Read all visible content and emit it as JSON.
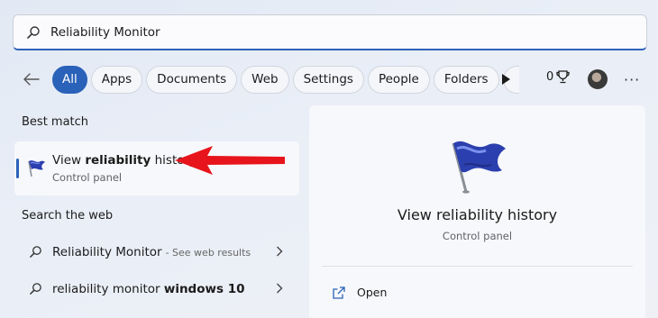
{
  "search": {
    "query": "Reliability Monitor"
  },
  "filters": {
    "items": [
      "All",
      "Apps",
      "Documents",
      "Web",
      "Settings",
      "People",
      "Folders"
    ],
    "active": "All",
    "points": "0"
  },
  "best_match": {
    "label": "Best match",
    "title_pre": "View ",
    "title_bold": "reliability",
    "title_post": " history",
    "subtitle": "Control panel"
  },
  "web": {
    "label": "Search the web",
    "results": [
      {
        "text": "Reliability Monitor",
        "bold": "",
        "suffix": " - See web results"
      },
      {
        "text": "reliability monitor ",
        "bold": "windows 10",
        "suffix": ""
      }
    ]
  },
  "preview": {
    "title": "View reliability history",
    "subtitle": "Control panel",
    "actions": [
      "Open"
    ]
  },
  "colors": {
    "accent": "#2a62b9",
    "arrow": "#e8141b"
  }
}
